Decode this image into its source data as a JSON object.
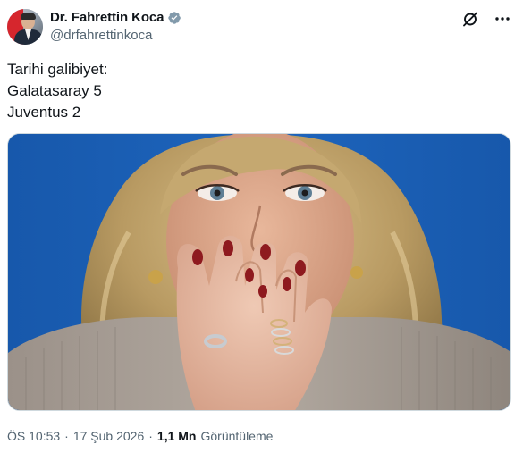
{
  "author": {
    "display_name": "Dr. Fahrettin Koca",
    "handle": "@drfahrettinkoca",
    "verified": true,
    "avatar_icon": "profile-photo"
  },
  "actions": {
    "grok_icon": "slashed-circle-icon",
    "more_icon": "more-dots-icon"
  },
  "tweet": {
    "lines": [
      "Tarihi galibiyet:",
      "Galatasaray 5",
      "Juventus 2"
    ]
  },
  "media": {
    "type": "photo",
    "description_icon": "photo"
  },
  "meta": {
    "time": "ÖS 10:53",
    "separator": "·",
    "date": "17 Şub 2026",
    "views_count": "1,1 Mn",
    "views_label": "Görüntüleme"
  },
  "colors": {
    "verified_badge": "#829aab",
    "text_primary": "#0f1419",
    "text_secondary": "#536471",
    "media_background": "#1a5fb4"
  }
}
